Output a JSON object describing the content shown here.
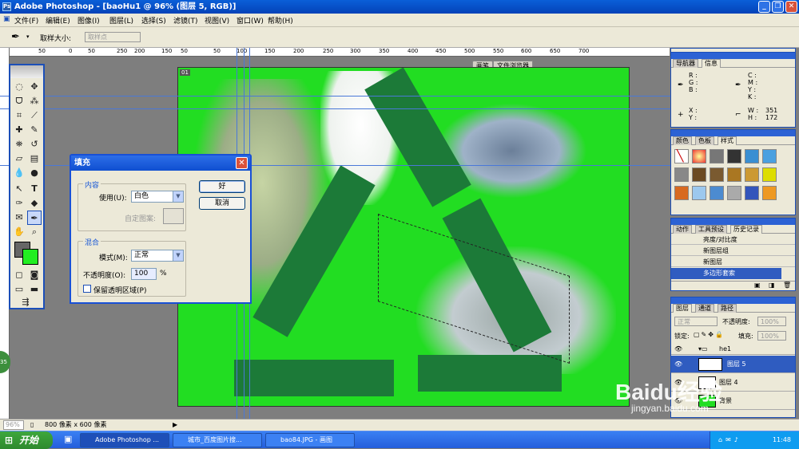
{
  "window": {
    "title": "Adobe Photoshop - [baoHu1 @ 96% (图层 5, RGB)]",
    "minimize": "_",
    "restore": "❐",
    "close": "✕"
  },
  "menu": [
    "文件(F)",
    "编辑(E)",
    "图像(I)",
    "图层(L)",
    "选择(S)",
    "滤镜(T)",
    "视图(V)",
    "窗口(W)",
    "帮助(H)"
  ],
  "options": {
    "sample_size_label": "取样大小:",
    "sample_size_value": "取样点",
    "palette_tabs": [
      "画笔",
      "文件浏览器"
    ]
  },
  "rulers": {
    "top": [
      "50",
      "0",
      "50",
      "250",
      "200",
      "150",
      "100",
      "50",
      "0",
      "50",
      "100",
      "150",
      "200",
      "250",
      "300",
      "350",
      "400",
      "450",
      "500",
      "550",
      "600",
      "650",
      "700"
    ]
  },
  "document": {
    "corner_label": "01"
  },
  "fill_dialog": {
    "title": "填充",
    "contents_group": "内容",
    "use_label": "使用(U):",
    "use_value": "白色",
    "custom_pattern_label": "自定图案:",
    "blending_group": "混合",
    "mode_label": "模式(M):",
    "mode_value": "正常",
    "opacity_label": "不透明度(O):",
    "opacity_value": "100",
    "opacity_unit": "%",
    "preserve_label": "保留透明区域(P)",
    "ok": "好",
    "cancel": "取消"
  },
  "navigator": {
    "tabs": [
      "导航器",
      "信息"
    ],
    "rgb": "R :\nG :\nB :",
    "cmyk": "C :\nM :\nY :\nK :",
    "xy": "X :\nY :",
    "w_label": "W :",
    "h_label": "H :",
    "w": "351",
    "h": "172"
  },
  "swatches": {
    "tabs": [
      "颜色",
      "色板",
      "样式"
    ]
  },
  "history": {
    "tabs": [
      "动作",
      "工具预设",
      "历史记录"
    ],
    "items": [
      "亮度/对比度",
      "新图层组",
      "新图层",
      "多边形套索"
    ]
  },
  "layers": {
    "tabs": [
      "图层",
      "通道",
      "路径"
    ],
    "blend": "正常",
    "opacity_label": "不透明度:",
    "opacity": "100%",
    "lock_label": "锁定:",
    "fill_label": "填充:",
    "fill": "100%",
    "rows": [
      "he1",
      "图层 5",
      "图层 4",
      "背景"
    ]
  },
  "status": {
    "zoom": "96%",
    "doc_size": "800 像素 x 600 像素"
  },
  "taskbar": {
    "start": "开始",
    "tasks": [
      "Adobe Photoshop ...",
      "城市_百度图片搜...",
      "bao84.JPG - 画图"
    ],
    "clock": "11:48"
  },
  "watermark": {
    "brand": "Baidu经验",
    "url": "jingyan.baidu.com"
  },
  "colors": {
    "canvas": "#22dd22",
    "arrow": "#1c7a38",
    "title": "#0a5fd8",
    "fg": "#666666",
    "bg": "#22ee22"
  }
}
